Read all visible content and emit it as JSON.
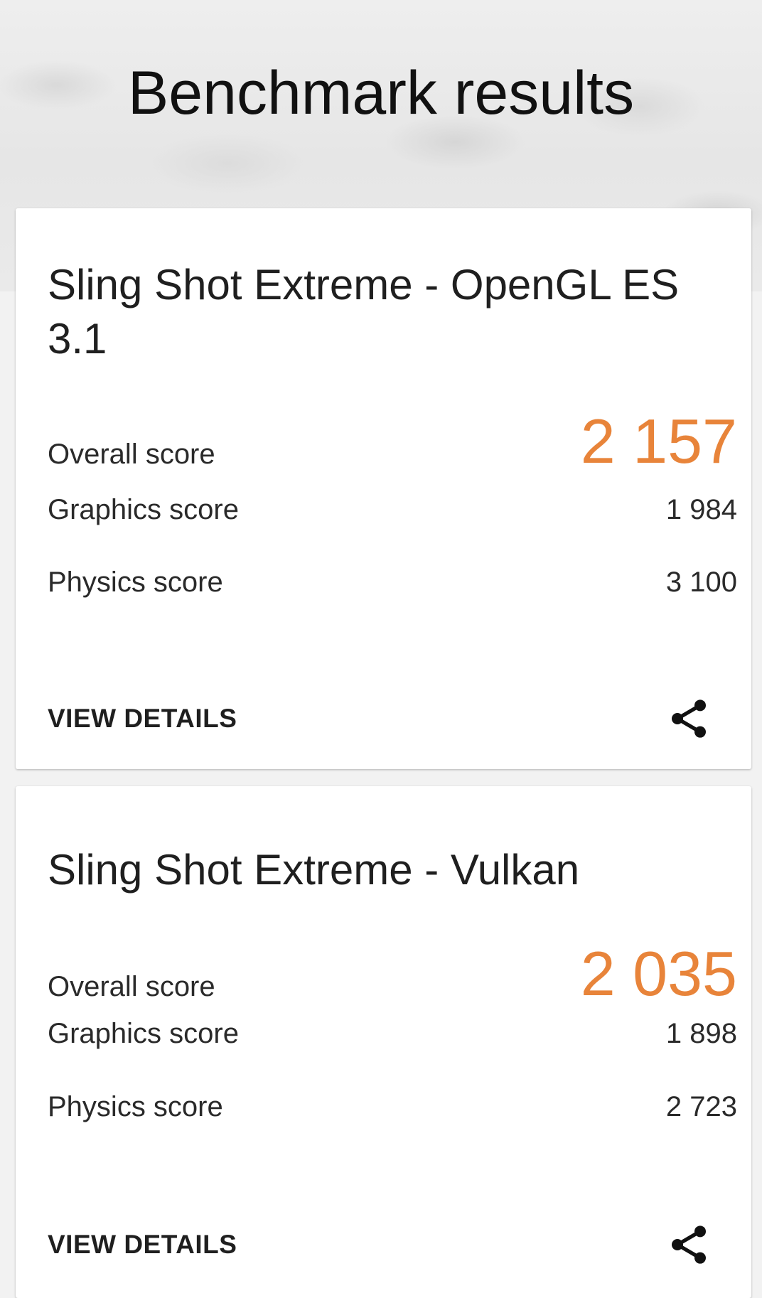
{
  "header": {
    "title": "Benchmark results"
  },
  "results": [
    {
      "test_name": "Sling Shot Extreme - OpenGL ES 3.1",
      "overall_label": "Overall score",
      "overall_value": "2 157",
      "graphics_label": "Graphics score",
      "graphics_value": "1 984",
      "physics_label": "Physics score",
      "physics_value": "3 100",
      "view_details_label": "VIEW DETAILS",
      "share_icon": "share-icon"
    },
    {
      "test_name": "Sling Shot Extreme - Vulkan",
      "overall_label": "Overall score",
      "overall_value": "2 035",
      "graphics_label": "Graphics score",
      "graphics_value": "1 898",
      "physics_label": "Physics score",
      "physics_value": "2 723",
      "view_details_label": "VIEW DETAILS",
      "share_icon": "share-icon"
    }
  ],
  "colors": {
    "accent": "#e8843a",
    "text": "#1f1f1f",
    "card_background": "#ffffff",
    "page_background": "#f2f2f2"
  }
}
